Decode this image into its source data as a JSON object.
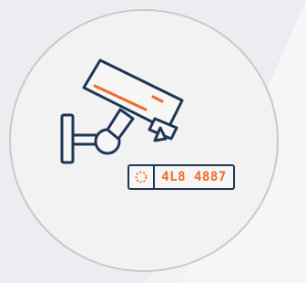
{
  "icon": {
    "name": "cctv-license-plate-recognition-icon",
    "colors": {
      "outline": "#1f3554",
      "accent": "#f26a2a",
      "circle_fill": "#f2f2f2",
      "circle_border": "#c9c9c9"
    }
  },
  "plate": {
    "text": "4L8 4887"
  }
}
